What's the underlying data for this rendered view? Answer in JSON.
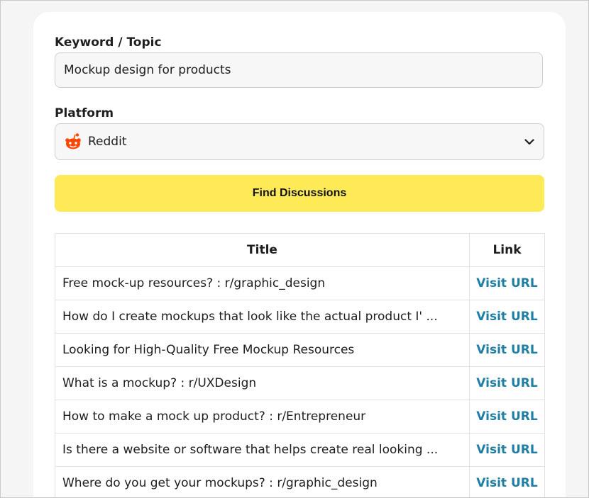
{
  "form": {
    "keyword_label": "Keyword / Topic",
    "keyword_value": "Mockup design for products",
    "platform_label": "Platform",
    "platform_value": "Reddit",
    "submit_label": "Find Discussions"
  },
  "table": {
    "headers": [
      "Title",
      "Link"
    ],
    "rows": [
      {
        "title": "Free mock-up resources? : r/graphic_design",
        "link": "Visit URL"
      },
      {
        "title": "How do I create mockups that look like the actual product I' ...",
        "link": "Visit URL"
      },
      {
        "title": "Looking for High-Quality Free Mockup Resources",
        "link": "Visit URL"
      },
      {
        "title": "What is a mockup? : r/UXDesign",
        "link": "Visit URL"
      },
      {
        "title": "How to make a mock up product? : r/Entrepreneur",
        "link": "Visit URL"
      },
      {
        "title": "Is there a website or software that helps create real looking ...",
        "link": "Visit URL"
      },
      {
        "title": "Where do you get your mockups? : r/graphic_design",
        "link": "Visit URL"
      }
    ]
  },
  "colors": {
    "button_bg": "#fdea56",
    "link": "#1f7ea3",
    "reddit_orange": "#ff4500"
  },
  "icons": {
    "platform_icon": "reddit-icon",
    "select_icon": "chevron-down-icon"
  }
}
